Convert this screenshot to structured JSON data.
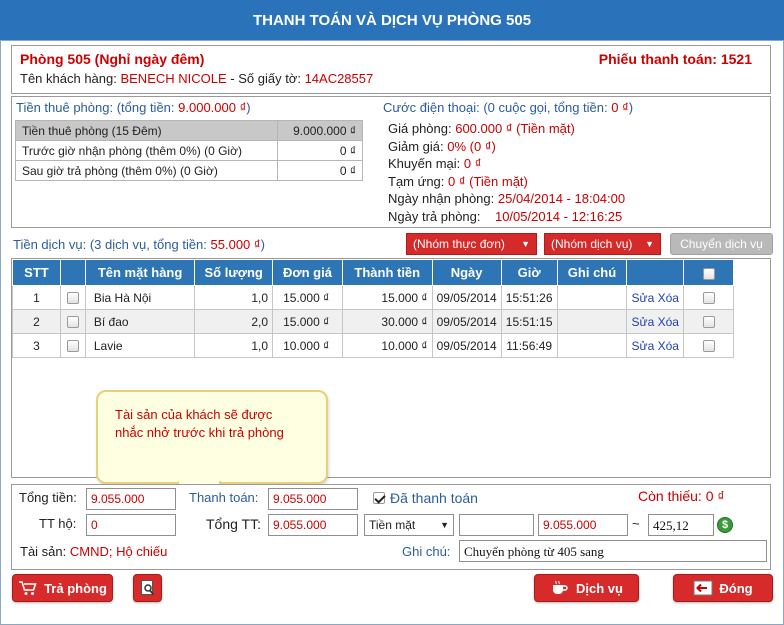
{
  "window": {
    "title": "THANH TOÁN VÀ DỊCH VỤ PHÒNG 505"
  },
  "header": {
    "room": "Phòng 505 (Nghỉ ngày đêm)",
    "receipt": "Phiếu thanh toán: 1521",
    "guest_label": "Tên khách hàng: ",
    "guest_name": "BENECH NICOLE",
    "id_label": " - Số giấy tờ: ",
    "id_value": "14AC28557"
  },
  "rent": {
    "label": "Tiền thuê phòng: (tổng tiền: ",
    "total": "9.000.000 ₫",
    "close": ")",
    "rows": [
      {
        "name": "Tiền thuê phòng (15 Đêm)",
        "value": "9.000.000 ₫"
      },
      {
        "name": "Trước giờ nhận phòng (thêm 0%) (0 Giờ)",
        "value": "0 ₫"
      },
      {
        "name": "Sau giờ trả phòng (thêm 0%) (0 Giờ)",
        "value": "0 ₫"
      }
    ]
  },
  "phone": {
    "label": "Cước điện thoại: (0 cuộc gọi, tổng tiền: ",
    "total": "0 ₫",
    "close": ")",
    "details": [
      {
        "label": "Giá phòng: ",
        "value": "600.000 ₫ (Tiền mặt)"
      },
      {
        "label": "Giảm giá: ",
        "value": "0% (0 ₫)"
      },
      {
        "label": "Khuyến mại: ",
        "value": "0 ₫"
      },
      {
        "label": "Tạm ứng: ",
        "value": "0 ₫ (Tiền mặt)"
      },
      {
        "label": "Ngày nhận phòng: ",
        "value": "25/04/2014 - 18:04:00"
      },
      {
        "label": "Ngày trả phòng:",
        "value": "10/05/2014 - 12:16:25"
      }
    ]
  },
  "services": {
    "label": "Tiền dịch vụ: (3 dịch vụ, tổng tiền: ",
    "total": "55.000 ₫",
    "close": ")",
    "menu_group": "(Nhóm thực đơn)",
    "service_group": "(Nhóm dịch vụ)",
    "transfer_button": "Chuyển dịch vụ",
    "columns": [
      "STT",
      "",
      "Tên mặt hàng",
      "Số lượng",
      "Đơn giá",
      "Thành tiền",
      "Ngày",
      "Giờ",
      "Ghi chú",
      "",
      ""
    ],
    "edit_label": "Sửa",
    "delete_label": "Xóa",
    "rows": [
      {
        "stt": "1",
        "name": "Bia Hà Nội",
        "qty": "1,0",
        "price": "15.000 ₫",
        "amount": "15.000 ₫",
        "date": "09/05/2014",
        "time": "15:51:26",
        "note": ""
      },
      {
        "stt": "2",
        "name": "Bí đao",
        "qty": "2,0",
        "price": "15.000 ₫",
        "amount": "30.000 ₫",
        "date": "09/05/2014",
        "time": "15:51:15",
        "note": ""
      },
      {
        "stt": "3",
        "name": "Lavie",
        "qty": "1,0",
        "price": "10.000 ₫",
        "amount": "10.000 ₫",
        "date": "09/05/2014",
        "time": "11:56:49",
        "note": ""
      }
    ]
  },
  "tooltip": {
    "line1": "Tài sản của khách sẽ được",
    "line2": "nhắc nhở trước khi trả phòng"
  },
  "summary": {
    "total_label": "Tổng tiền:",
    "total_value": "9.055.000",
    "payment_label": "Thanh toán:",
    "payment_value": "9.055.000",
    "paid_label": "Đã thanh toán",
    "remaining_label": "Còn thiếu: ",
    "remaining_value": "0 ₫",
    "tt_ho_label": "TT hộ:",
    "tt_ho_value": "0",
    "grand_label": "Tổng TT:",
    "grand_value": "9.055.000",
    "method": "Tiền mặt",
    "extra_value": "",
    "converted_value": "9.055.000",
    "tilde": "~",
    "foreign_value": "425,12",
    "assets_label": "Tài sản: ",
    "assets_value": "CMND; Hộ chiếu",
    "note_label": "Ghi chú:",
    "note_value": "Chuyển phòng từ 405 sang"
  },
  "actions": {
    "checkout": "Trả phòng",
    "service": "Dịch vụ",
    "close": "Đóng"
  },
  "colors": {
    "accent": "#2a73ba",
    "danger": "#d72a2a",
    "money": "#cc0000"
  }
}
